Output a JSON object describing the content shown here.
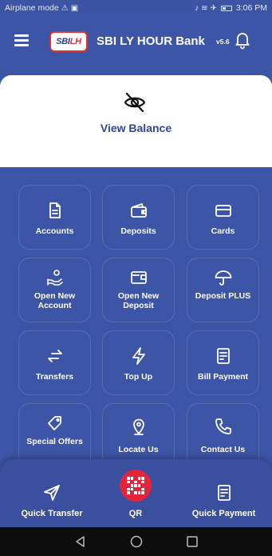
{
  "status_bar": {
    "left_text": "Airplane mode",
    "time": "3:06 PM"
  },
  "app_bar": {
    "logo_text_main": "SBI",
    "logo_text_accent": "LH",
    "title": "SBI LY HOUR Bank",
    "version": "v5.6",
    "menu_icon": "hamburger-icon",
    "notification_icon": "bell-icon"
  },
  "balance": {
    "icon": "eye-off-icon",
    "label": "View Balance"
  },
  "tiles": [
    {
      "label": "Accounts",
      "icon": "document-icon"
    },
    {
      "label": "Deposits",
      "icon": "wallet-icon"
    },
    {
      "label": "Cards",
      "icon": "card-icon"
    },
    {
      "label": "Open New Account",
      "icon": "hand-coin-icon"
    },
    {
      "label": "Open New Deposit",
      "icon": "wallet-add-icon"
    },
    {
      "label": "Deposit PLUS",
      "icon": "umbrella-icon"
    },
    {
      "label": "Transfers",
      "icon": "transfer-arrows-icon"
    },
    {
      "label": "Top Up",
      "icon": "lightning-icon"
    },
    {
      "label": "Bill Payment",
      "icon": "bill-icon"
    },
    {
      "label": "Special Offers",
      "icon": "tag-icon"
    },
    {
      "label": "Locate Us",
      "icon": "location-pin-icon"
    },
    {
      "label": "Contact Us",
      "icon": "phone-icon"
    }
  ],
  "bottom_bar": {
    "quick_transfer": "Quick Transfer",
    "qr": "QR",
    "quick_payment": "Quick Payment"
  },
  "colors": {
    "primary": "#3d55a6",
    "accent_red": "#e5243b",
    "text_blue": "#30469a"
  }
}
